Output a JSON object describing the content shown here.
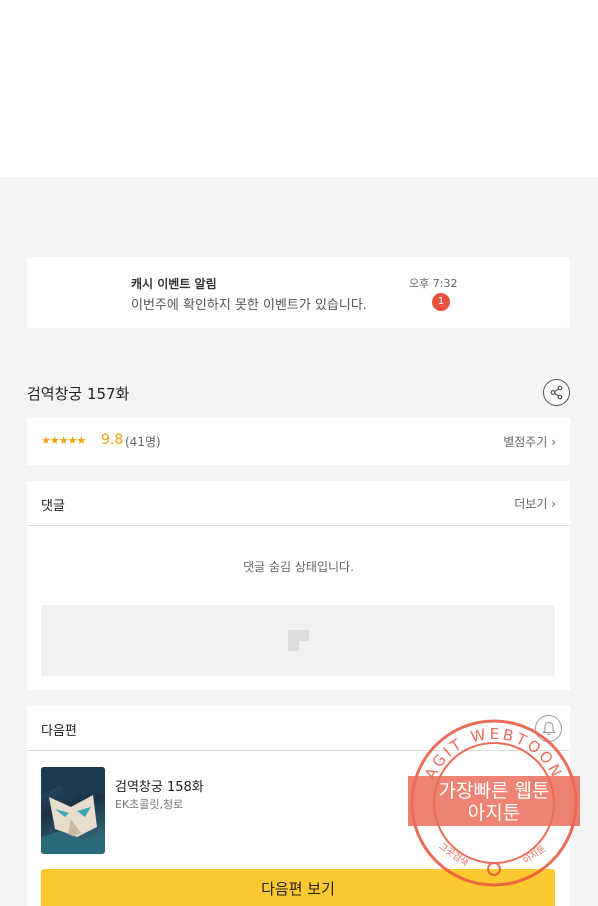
{
  "notice": {
    "title": "캐시 이벤트 알림",
    "message": "이번주에 확인하지 못한 이벤트가 있습니다.",
    "time": "오후 7:32",
    "badge": "1"
  },
  "episode": {
    "title": "검역창궁 157화",
    "share_icon": "share-icon"
  },
  "rating": {
    "stars": "★★★★★",
    "score": "9.8",
    "count": "(41명)",
    "rate_link": "별점주기 ›"
  },
  "comments": {
    "label": "댓글",
    "more": "더보기 ›",
    "hidden_message": "댓글 숨김 상태입니다."
  },
  "next_episode": {
    "section_label": "다음편",
    "title": "검역창궁 158화",
    "authors": "EK초콜릿,청로",
    "button_label": "다음편 보기",
    "bell_icon": "bell-icon"
  },
  "watermark": {
    "ring_text": "AGIT WEBTOON",
    "line1": "가장빠른 웹툰",
    "line2": "아지툰",
    "bottom_left": "그곳검색",
    "bottom_right": "아지툰",
    "color": "#e8533d"
  }
}
